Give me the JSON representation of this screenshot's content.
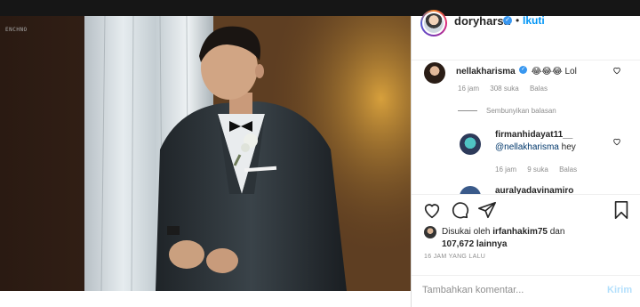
{
  "post": {
    "photo_tag": "ENCHNO"
  },
  "header": {
    "username": "doryharsa",
    "separator": "•",
    "follow_label": "Ikuti"
  },
  "comments": [
    {
      "username": "nellakharisma",
      "text": "😂😂😂 Lol",
      "time": "16 jam",
      "likes": "308 suka",
      "reply_label": "Balas"
    }
  ],
  "hide_replies_label": "Sembunyikan balasan",
  "replies": [
    {
      "username": "firmanhidayat11__",
      "mention": "@nellakharisma",
      "text": "hey",
      "time": "16 jam",
      "likes": "9 suka",
      "reply_label": "Balas"
    },
    {
      "username": "auralyadavinamiro"
    }
  ],
  "likes": {
    "prefix": "Disukai oleh",
    "user": "irfanhakim75",
    "connector": "dan",
    "count": "107,672 lainnya"
  },
  "timestamp": "16 JAM YANG LALU",
  "comment_box": {
    "placeholder": "Tambahkan komentar...",
    "send_label": "Kirim"
  },
  "icons": [
    "heart-icon",
    "comment-icon",
    "share-icon",
    "bookmark-icon",
    "verified-icon"
  ],
  "colors": {
    "link": "#0095f6",
    "verified": "#3897f0",
    "send_disabled": "#b2dffc",
    "muted": "#8e8e8e"
  }
}
